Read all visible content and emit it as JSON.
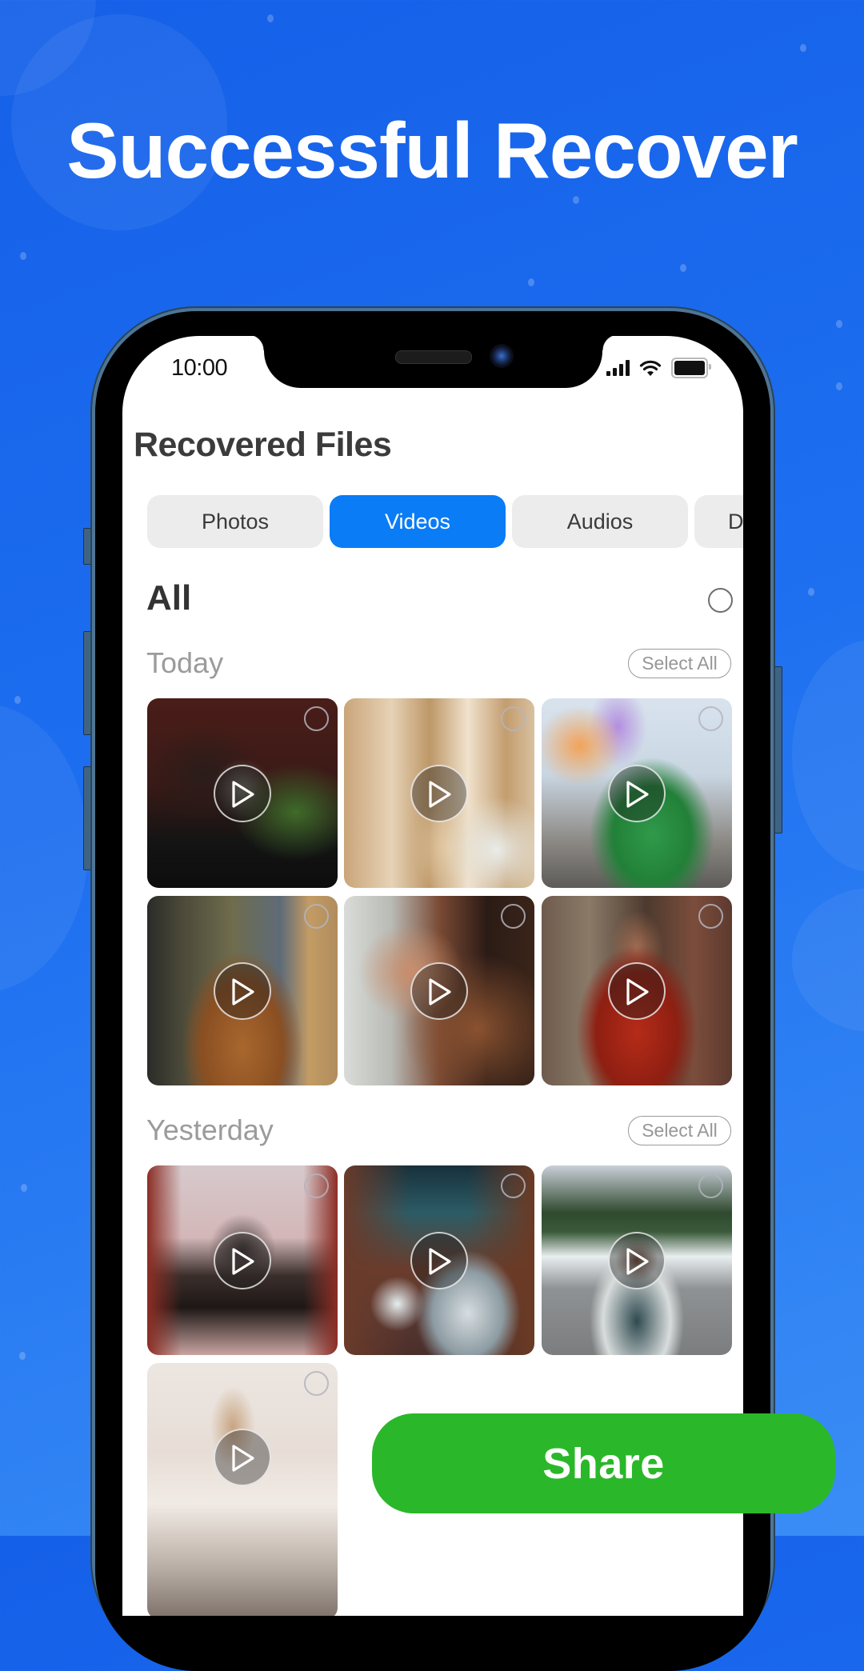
{
  "headline": "Successful Recover",
  "status_bar": {
    "time": "10:00",
    "icons": [
      "cellular-signal-icon",
      "wifi-icon",
      "battery-icon"
    ]
  },
  "screen": {
    "title": "Recovered Files",
    "tabs": [
      {
        "label": "Photos",
        "active": false
      },
      {
        "label": "Videos",
        "active": true
      },
      {
        "label": "Audios",
        "active": false
      },
      {
        "label": "D",
        "active": false
      }
    ],
    "all_label": "All",
    "sections": [
      {
        "label": "Today",
        "select_all_label": "Select All",
        "items": [
          {
            "type": "video",
            "subject": "couple-on-leather-chair"
          },
          {
            "type": "video",
            "subject": "desk-lamp-office"
          },
          {
            "type": "video",
            "subject": "rider-lanterns-street"
          },
          {
            "type": "video",
            "subject": "toddler-holding-hands"
          },
          {
            "type": "video",
            "subject": "couple-embrace"
          },
          {
            "type": "video",
            "subject": "man-red-shirt-wall"
          }
        ]
      },
      {
        "label": "Yesterday",
        "select_all_label": "Select All",
        "items": [
          {
            "type": "video",
            "subject": "canal-warehouses"
          },
          {
            "type": "video",
            "subject": "desert-tents-night"
          },
          {
            "type": "video",
            "subject": "woman-snowy-road"
          },
          {
            "type": "video",
            "subject": "white-town-tower"
          }
        ]
      }
    ],
    "share_label": "Share"
  },
  "colors": {
    "background_blue": "#1a66ec",
    "active_tab": "#0a7cf6",
    "inactive_tab": "#ececec",
    "share_green": "#2bb72a",
    "section_label_gray": "#9b9b9b"
  }
}
